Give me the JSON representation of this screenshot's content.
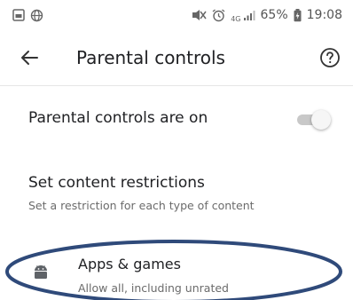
{
  "status_bar": {
    "signal_label": "4G",
    "battery": "65%",
    "time": "19:08"
  },
  "toolbar": {
    "title": "Parental controls"
  },
  "settings": {
    "toggle_row": {
      "label": "Parental controls are on",
      "enabled": true
    },
    "content_restrictions": {
      "title": "Set content restrictions",
      "subtitle": "Set a restriction for each type of content"
    },
    "apps_games": {
      "title": "Apps & games",
      "subtitle": "Allow all, including unrated"
    }
  },
  "colors": {
    "annotation_ellipse": "#2f4a7a",
    "toggle_track": "#c8c8c8",
    "toggle_thumb": "#f6f6f6"
  }
}
